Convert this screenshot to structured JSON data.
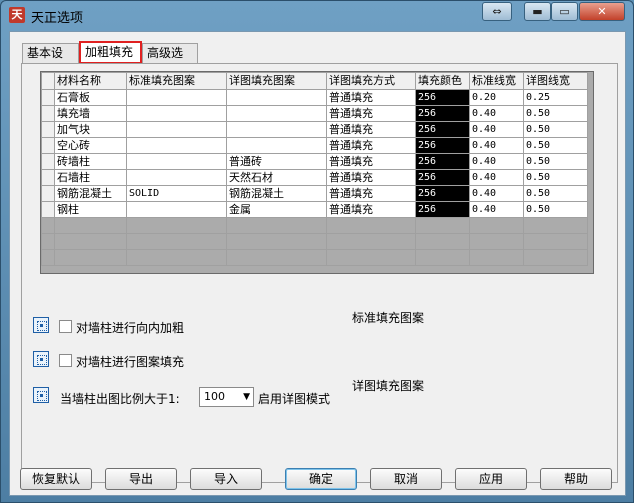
{
  "window": {
    "title": "天正选项",
    "app_icon": "天",
    "controls": {
      "restore": "⇔",
      "minimize": "▬",
      "maximize": "▭",
      "close": "✕"
    }
  },
  "tabs": [
    {
      "label": "基本设定",
      "active": false
    },
    {
      "label": "加粗填充",
      "active": true
    },
    {
      "label": "高级选项",
      "active": false
    }
  ],
  "table": {
    "headers": [
      "材料名称",
      "标准填充图案",
      "详图填充图案",
      "详图填充方式",
      "填充颜色",
      "标准线宽",
      "详图线宽"
    ],
    "rows": [
      [
        "石膏板",
        "",
        "",
        "普通填充",
        "256",
        "0.20",
        "0.25"
      ],
      [
        "填充墙",
        "",
        "",
        "普通填充",
        "256",
        "0.40",
        "0.50"
      ],
      [
        "加气块",
        "",
        "",
        "普通填充",
        "256",
        "0.40",
        "0.50"
      ],
      [
        "空心砖",
        "",
        "",
        "普通填充",
        "256",
        "0.40",
        "0.50"
      ],
      [
        "砖墙柱",
        "",
        "普通砖",
        "普通填充",
        "256",
        "0.40",
        "0.50"
      ],
      [
        "石墙柱",
        "",
        "天然石材",
        "普通填充",
        "256",
        "0.40",
        "0.50"
      ],
      [
        "钢筋混凝土",
        "SOLID",
        "钢筋混凝土",
        "普通填充",
        "256",
        "0.40",
        "0.50"
      ],
      [
        "钢柱",
        "",
        "金属",
        "普通填充",
        "256",
        "0.40",
        "0.50"
      ]
    ],
    "color_cell_bg": "#000000"
  },
  "options": {
    "inward_bold": {
      "label": "对墙柱进行向内加粗",
      "checked": false
    },
    "pattern_fill": {
      "label": "对墙柱进行图案填充",
      "checked": false
    },
    "scale_label": "当墙柱出图比例大于1:",
    "scale_value": "100",
    "scale_suffix": "启用详图模式"
  },
  "preview_labels": {
    "standard": "标准填充图案",
    "detail": "详图填充图案"
  },
  "buttons": {
    "restore_defaults": "恢复默认",
    "export": "导出",
    "import": "导入",
    "ok": "确定",
    "cancel": "取消",
    "apply": "应用",
    "help": "帮助"
  }
}
